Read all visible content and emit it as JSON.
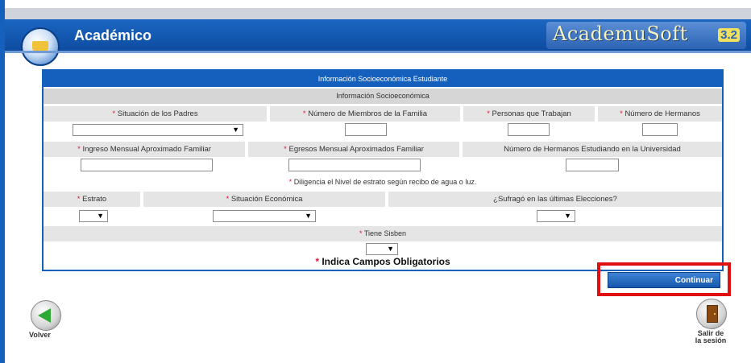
{
  "header": {
    "title": "Académico",
    "brand": "AcademuSoft",
    "version": "3.2"
  },
  "form": {
    "title": "Información Socioeconómica Estudiante",
    "section": "Información Socioeconómica",
    "row1": {
      "padres": "Situación de los Padres",
      "miembros": "Número de Miembros de la Familia",
      "trabajan": "Personas que Trabajan",
      "hermanos": "Número de Hermanos"
    },
    "row2": {
      "ingreso": "Ingreso Mensual Aproximado Familiar",
      "egresos": "Egresos Mensual Aproximados Familiar",
      "hermanos_univ": "Número de Hermanos Estudiando en la Universidad"
    },
    "note": "Diligencia el Nivel de estrato según recibo de agua o luz.",
    "row3": {
      "estrato": "Estrato",
      "situacion": "Situación Económica",
      "sufrago": "¿Sufragó en las últimas Elecciones?"
    },
    "sisben": "Tiene Sisben",
    "required_mark": "*",
    "legend": "Indica Campos Obligatorios",
    "select_arrow": "▼"
  },
  "buttons": {
    "continue": "Continuar",
    "back": "Volver",
    "exit_line1": "Salir de",
    "exit_line2": "la sesión"
  }
}
